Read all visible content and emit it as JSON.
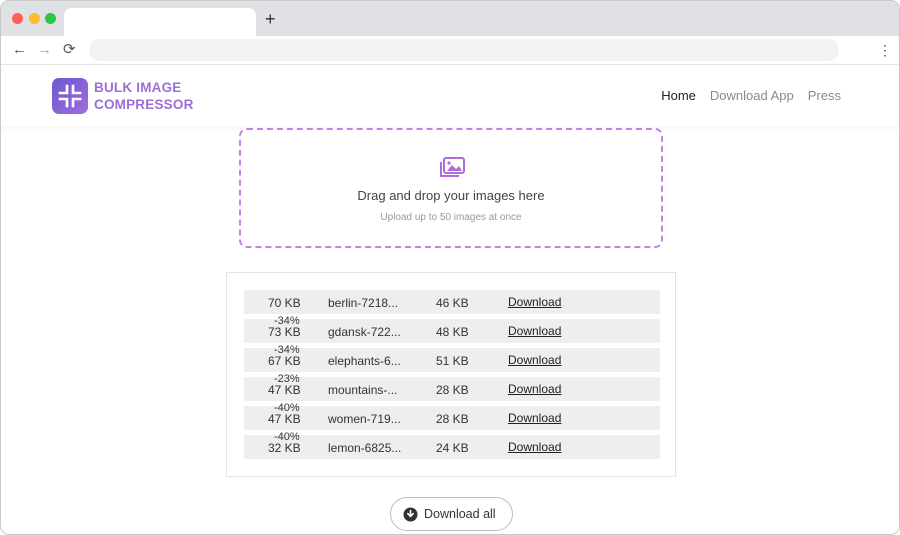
{
  "browser": {
    "new_tab_glyph": "+",
    "back_glyph": "←",
    "forward_glyph": "→",
    "reload_glyph": "⟳",
    "menu_glyph": "⋮"
  },
  "site": {
    "logo_line1": "BULK IMAGE",
    "logo_line2": "COMPRESSOR",
    "nav": [
      "Home",
      "Download App",
      "Press"
    ]
  },
  "dropzone": {
    "title": "Drag and drop your images here",
    "subtitle": "Upload up to 50 images at once"
  },
  "results": [
    {
      "original": "70 KB",
      "percent": "",
      "file": "berlin-7218...",
      "compressed": "46 KB",
      "action": "Download"
    },
    {
      "original": "73 KB",
      "percent": "-34%",
      "file": "gdansk-722...",
      "compressed": "48 KB",
      "action": "Download"
    },
    {
      "original": "67 KB",
      "percent": "-34%",
      "file": "elephants-6...",
      "compressed": "51 KB",
      "action": "Download"
    },
    {
      "original": "47 KB",
      "percent": "-23%",
      "file": "mountains-...",
      "compressed": "28 KB",
      "action": "Download"
    },
    {
      "original": "47 KB",
      "percent": "-40%",
      "file": "women-719...",
      "compressed": "28 KB",
      "action": "Download"
    },
    {
      "original": "32 KB",
      "percent": "-40%",
      "file": "lemon-6825...",
      "compressed": "24 KB",
      "action": "Download"
    }
  ],
  "download_all_label": "Download all",
  "colors": {
    "accent": "#c184e6",
    "logo_gradient_start": "#6a5acd",
    "logo_gradient_end": "#a36be0"
  }
}
